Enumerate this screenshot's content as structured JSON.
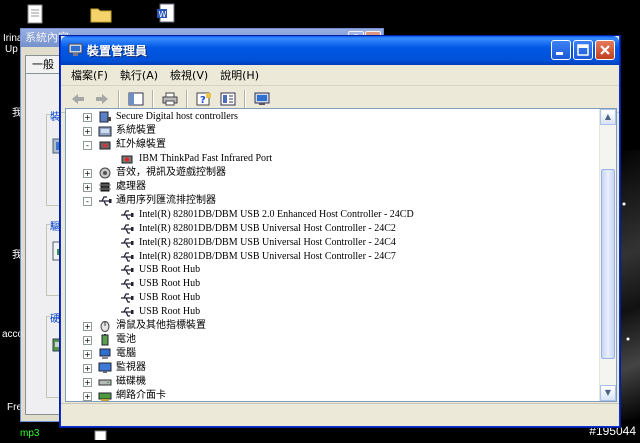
{
  "desktop": {
    "left_texts": [
      "Irina",
      "Up",
      "我",
      "我",
      "acco",
      "Fre"
    ],
    "bottom_text": "mp3",
    "watermark": "#195044"
  },
  "back_window": {
    "title": "系統內容",
    "tab_label": "一般",
    "group_labels": [
      "裝置",
      "驅動",
      "硬體"
    ],
    "help_glyph": "?",
    "close_glyph": "x"
  },
  "window": {
    "title": "裝置管理員",
    "buttons": {
      "minimize": "_",
      "maximize": "□",
      "close": "×"
    },
    "menu": [
      "檔案(F)",
      "執行(A)",
      "檢視(V)",
      "說明(H)"
    ],
    "tree": [
      {
        "label": "Secure Digital host controllers",
        "expander": "+",
        "icon": "sd-card-icon"
      },
      {
        "label": "系統裝置",
        "expander": "+",
        "icon": "system-device-icon"
      },
      {
        "label": "紅外線裝置",
        "expander": "-",
        "icon": "infrared-icon"
      },
      {
        "label": "IBM ThinkPad Fast Infrared Port",
        "expander": "",
        "icon": "infrared-device-icon"
      },
      {
        "label": "音效，視訊及遊戲控制器",
        "expander": "+",
        "icon": "sound-icon"
      },
      {
        "label": "處理器",
        "expander": "+",
        "icon": "processor-icon"
      },
      {
        "label": "通用序列匯流排控制器",
        "expander": "-",
        "icon": "usb-icon"
      },
      {
        "label": "Intel(R) 82801DB/DBM USB 2.0 Enhanced Host Controller - 24CD",
        "expander": "",
        "icon": "usb-device-icon"
      },
      {
        "label": "Intel(R) 82801DB/DBM USB Universal Host Controller - 24C2",
        "expander": "",
        "icon": "usb-device-icon"
      },
      {
        "label": "Intel(R) 82801DB/DBM USB Universal Host Controller - 24C4",
        "expander": "",
        "icon": "usb-device-icon"
      },
      {
        "label": "Intel(R) 82801DB/DBM USB Universal Host Controller - 24C7",
        "expander": "",
        "icon": "usb-device-icon"
      },
      {
        "label": "USB Root Hub",
        "expander": "",
        "icon": "usb-device-icon"
      },
      {
        "label": "USB Root Hub",
        "expander": "",
        "icon": "usb-device-icon"
      },
      {
        "label": "USB Root Hub",
        "expander": "",
        "icon": "usb-device-icon"
      },
      {
        "label": "USB Root Hub",
        "expander": "",
        "icon": "usb-device-icon"
      },
      {
        "label": "滑鼠及其他指標裝置",
        "expander": "+",
        "icon": "mouse-icon"
      },
      {
        "label": "電池",
        "expander": "+",
        "icon": "battery-icon"
      },
      {
        "label": "電腦",
        "expander": "+",
        "icon": "computer-icon"
      },
      {
        "label": "監視器",
        "expander": "+",
        "icon": "monitor-icon"
      },
      {
        "label": "磁碟機",
        "expander": "+",
        "icon": "disk-drive-icon"
      },
      {
        "label": "網路介面卡",
        "expander": "+",
        "icon": "network-adapter-icon"
      }
    ],
    "scroll": {
      "up": "▲",
      "down": "▼"
    }
  },
  "colors": {
    "titlebar": "#0058e6",
    "close": "#c2401f",
    "tree_bg": "#ffffff"
  }
}
